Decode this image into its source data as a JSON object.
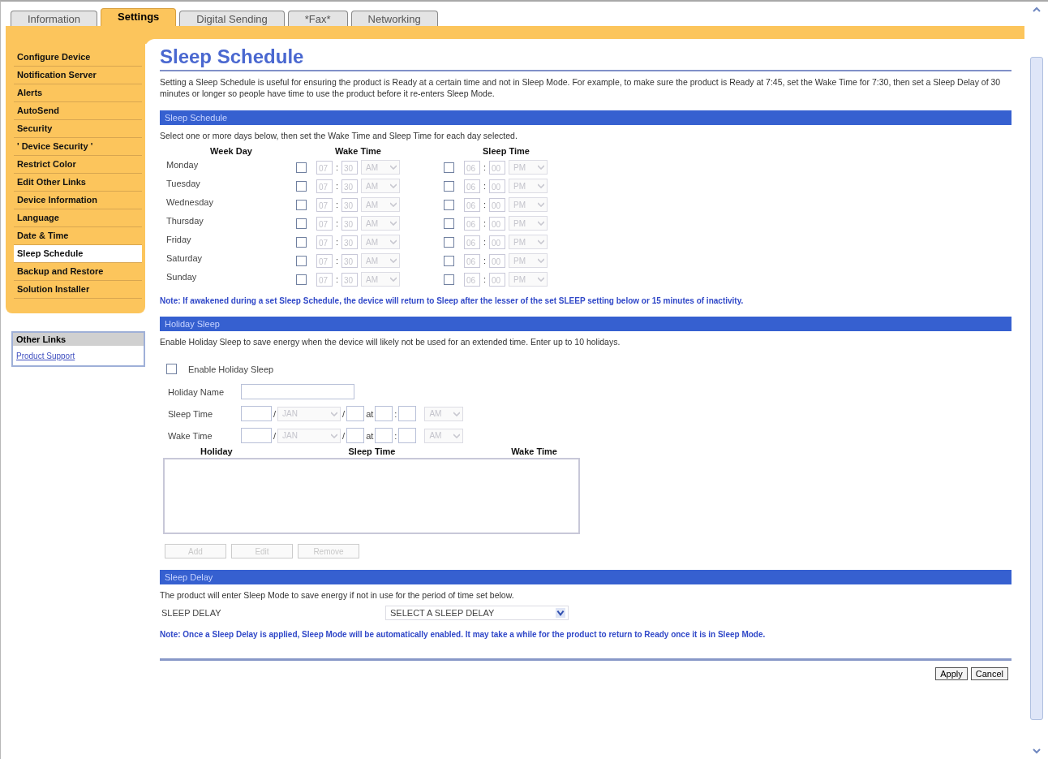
{
  "tabs": [
    {
      "label": "Information",
      "selected": false
    },
    {
      "label": "Settings",
      "selected": true
    },
    {
      "label": "Digital Sending",
      "selected": false
    },
    {
      "label": "*Fax*",
      "selected": false
    },
    {
      "label": "Networking",
      "selected": false
    }
  ],
  "sidebar": {
    "items": [
      {
        "label": "Configure Device",
        "selected": false
      },
      {
        "label": "Notification Server",
        "selected": false
      },
      {
        "label": "Alerts",
        "selected": false
      },
      {
        "label": "AutoSend",
        "selected": false
      },
      {
        "label": "Security",
        "selected": false
      },
      {
        "label": "' Device Security '",
        "selected": false
      },
      {
        "label": "Restrict Color",
        "selected": false
      },
      {
        "label": "Edit Other Links",
        "selected": false
      },
      {
        "label": "Device Information",
        "selected": false
      },
      {
        "label": "Language",
        "selected": false
      },
      {
        "label": "Date & Time",
        "selected": false
      },
      {
        "label": "Sleep Schedule",
        "selected": true
      },
      {
        "label": "Backup and Restore",
        "selected": false
      },
      {
        "label": "Solution Installer",
        "selected": false
      }
    ],
    "other_links": {
      "title": "Other Links",
      "links": [
        "Product Support"
      ]
    }
  },
  "page": {
    "title": "Sleep Schedule",
    "intro": "Setting a Sleep Schedule is useful for ensuring the product is Ready at a certain time and not in Sleep Mode. For example, to make sure the product is Ready at 7:45, set the Wake Time for 7:30, then set a Sleep Delay of 30 minutes or longer so people have time to use the product before it re-enters Sleep Mode.",
    "schedule": {
      "title": "Sleep Schedule",
      "instruction": "Select one or more days below, then set the Wake Time and Sleep Time for each day selected.",
      "columns": [
        "Week Day",
        "Wake Time",
        "Sleep Time"
      ],
      "rows": [
        {
          "day": "Monday",
          "wake": {
            "checked": false,
            "hour": "07",
            "colon": ":",
            "minute": "30",
            "ampm": "AM"
          },
          "sleep": {
            "checked": false,
            "hour": "06",
            "colon": ":",
            "minute": "00",
            "ampm": "PM"
          }
        },
        {
          "day": "Tuesday",
          "wake": {
            "checked": false,
            "hour": "07",
            "colon": ":",
            "minute": "30",
            "ampm": "AM"
          },
          "sleep": {
            "checked": false,
            "hour": "06",
            "colon": ":",
            "minute": "00",
            "ampm": "PM"
          }
        },
        {
          "day": "Wednesday",
          "wake": {
            "checked": false,
            "hour": "07",
            "colon": ":",
            "minute": "30",
            "ampm": "AM"
          },
          "sleep": {
            "checked": false,
            "hour": "06",
            "colon": ":",
            "minute": "00",
            "ampm": "PM"
          }
        },
        {
          "day": "Thursday",
          "wake": {
            "checked": false,
            "hour": "07",
            "colon": ":",
            "minute": "30",
            "ampm": "AM"
          },
          "sleep": {
            "checked": false,
            "hour": "06",
            "colon": ":",
            "minute": "00",
            "ampm": "PM"
          }
        },
        {
          "day": "Friday",
          "wake": {
            "checked": false,
            "hour": "07",
            "colon": ":",
            "minute": "30",
            "ampm": "AM"
          },
          "sleep": {
            "checked": false,
            "hour": "06",
            "colon": ":",
            "minute": "00",
            "ampm": "PM"
          }
        },
        {
          "day": "Saturday",
          "wake": {
            "checked": false,
            "hour": "07",
            "colon": ":",
            "minute": "30",
            "ampm": "AM"
          },
          "sleep": {
            "checked": false,
            "hour": "06",
            "colon": ":",
            "minute": "00",
            "ampm": "PM"
          }
        },
        {
          "day": "Sunday",
          "wake": {
            "checked": false,
            "hour": "07",
            "colon": ":",
            "minute": "30",
            "ampm": "AM"
          },
          "sleep": {
            "checked": false,
            "hour": "06",
            "colon": ":",
            "minute": "00",
            "ampm": "PM"
          }
        }
      ],
      "note": "Note: If awakened during a set Sleep Schedule, the device will return to Sleep after the lesser of the set SLEEP setting below or 15 minutes of inactivity."
    },
    "holiday": {
      "title": "Holiday Sleep",
      "description": "Enable Holiday Sleep to save energy when the device will likely not be used for an extended time. Enter up to 10 holidays.",
      "enable": {
        "label": "Enable Holiday Sleep",
        "checked": false
      },
      "name_label": "Holiday Name",
      "times": [
        {
          "label": "Sleep Time",
          "slash_1": "/",
          "month": "JAN",
          "slash_2": "/",
          "at": "at",
          "colon": ":",
          "ampm": "AM"
        },
        {
          "label": "Wake Time",
          "slash_1": "/",
          "month": "JAN",
          "slash_2": "/",
          "at": "at",
          "colon": ":",
          "ampm": "AM"
        }
      ],
      "list_columns": [
        "Holiday",
        "Sleep Time",
        "Wake Time"
      ],
      "buttons": [
        {
          "label": "Add",
          "disabled": true
        },
        {
          "label": "Edit",
          "disabled": true
        },
        {
          "label": "Remove",
          "disabled": true
        }
      ]
    },
    "delay": {
      "title": "Sleep Delay",
      "description": "The product will enter Sleep Mode to save energy if not in use for the period of time set below.",
      "label": "SLEEP DELAY",
      "value": "SELECT A SLEEP DELAY",
      "note": "Note: Once a Sleep Delay is applied, Sleep Mode will be automatically enabled. It may take a while for the product to return to Ready once it is in Sleep Mode."
    },
    "buttons": [
      "Apply",
      "Cancel"
    ]
  }
}
